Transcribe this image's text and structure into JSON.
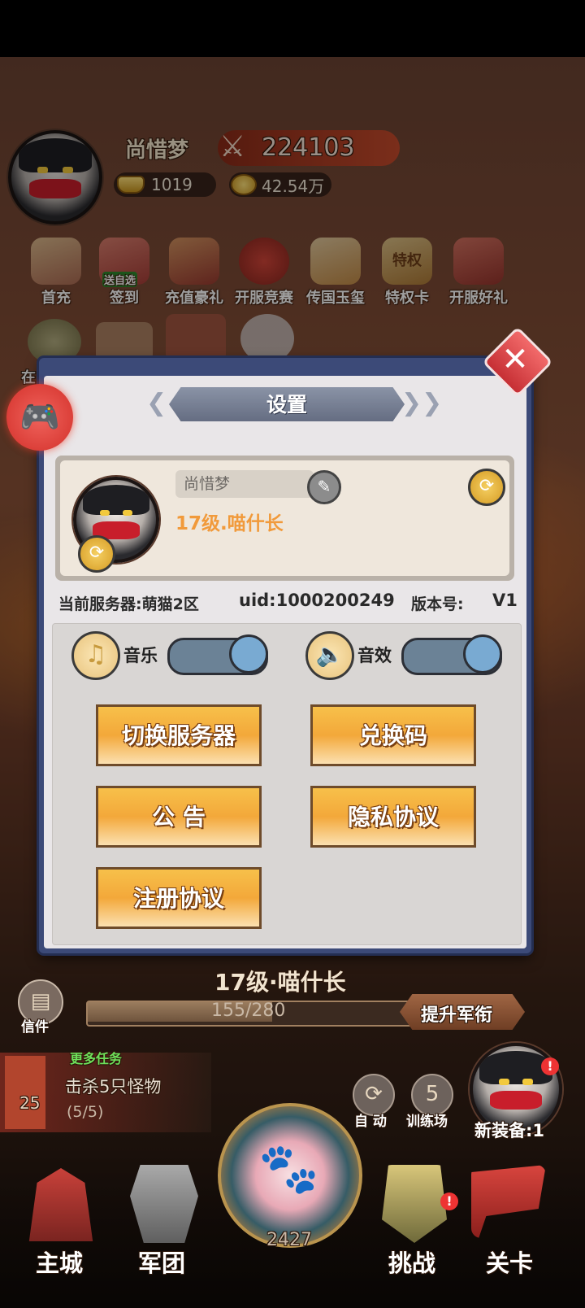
{
  "player": {
    "name": "尚惜梦",
    "power": "224103",
    "ingots": "1019",
    "gold": "42.54万"
  },
  "features_row1": [
    {
      "label": "首充",
      "icon": "first-recharge-icon"
    },
    {
      "label": "签到",
      "badge": "送自选",
      "icon": "signin-icon"
    },
    {
      "label": "充值豪礼",
      "icon": "recharge-gift-icon"
    },
    {
      "label": "开服竞赛",
      "icon": "server-race-icon"
    },
    {
      "label": "传国玉玺",
      "icon": "jade-seal-icon"
    },
    {
      "label": "特权卡",
      "icon": "privilege-card-icon",
      "card_text": "特权"
    },
    {
      "label": "开服好礼",
      "icon": "server-gift-icon"
    }
  ],
  "features_row2_partial": "在",
  "settings": {
    "title": "设置",
    "profile_name": "尚惜梦",
    "rank": "17级.喵什长",
    "server_label": "当前服务器:萌猫2区",
    "uid_label": "uid:1000200249",
    "version_label": "版本号:",
    "version_value": "V1",
    "music_label": "音乐",
    "sound_label": "音效",
    "music_on": true,
    "sound_on": true,
    "buttons": {
      "switch_server": "切换服务器",
      "redeem_code": "兑换码",
      "announcement": "公 告",
      "privacy": "隐私协议",
      "register": "注册协议"
    }
  },
  "hud": {
    "mail_label": "信件",
    "rank_title": "17级·喵什长",
    "xp_text": "155/280",
    "xp_fraction": 0.5536,
    "upgrade_label": "提升军衔",
    "quest_header": "更多任务",
    "quest_text": "击杀5只怪物",
    "quest_progress": "(5/5)",
    "quest_level": "25",
    "auto_label": "自 动",
    "training_label": "训练场",
    "training_count": "5",
    "new_equip": "新装备:1",
    "center_count": "2427"
  },
  "nav": {
    "main_city": "主城",
    "legion": "军团",
    "challenge": "挑战",
    "stage": "关卡"
  },
  "colors": {
    "dialog_frame": "#3c4a78",
    "button_orange": "#f3a83a",
    "close_red": "#d7393d"
  }
}
